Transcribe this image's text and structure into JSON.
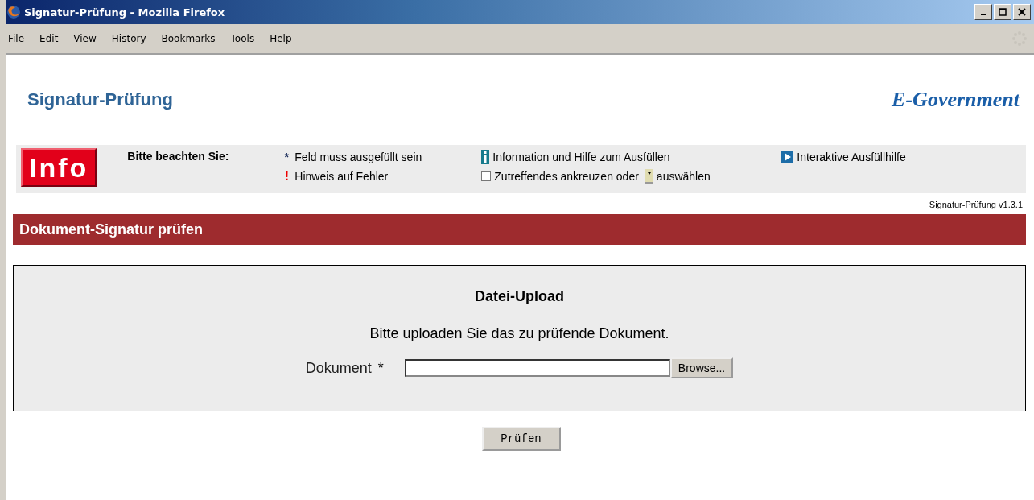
{
  "window": {
    "title": "Signatur-Prüfung - Mozilla Firefox"
  },
  "menu": [
    "File",
    "Edit",
    "View",
    "History",
    "Bookmarks",
    "Tools",
    "Help"
  ],
  "page": {
    "title": "Signatur-Prüfung",
    "logo": "E-Government",
    "version": "Signatur-Prüfung v1.3.1"
  },
  "info_bar": {
    "badge": "Info",
    "heading": "Bitte beachten Sie:",
    "columns": [
      [
        {
          "kind": "required",
          "symbol": "*",
          "text": "Feld muss ausgefüllt sein"
        },
        {
          "kind": "error",
          "symbol": "!",
          "text": "Hinweis auf Fehler"
        }
      ],
      [
        {
          "kind": "info",
          "text": "Information und Hilfe zum Ausfüllen"
        },
        {
          "kind": "checkbox",
          "text": "Zutreffendes ankreuzen oder",
          "text_after": "auswählen"
        }
      ],
      [
        {
          "kind": "interactive",
          "text": "Interaktive Ausfüllhilfe"
        }
      ]
    ]
  },
  "section": {
    "title": "Dokument-Signatur prüfen"
  },
  "upload": {
    "title": "Datei-Upload",
    "instruction": "Bitte uploaden Sie das zu prüfende Dokument.",
    "label": "Dokument",
    "required_mark": "*",
    "browse": "Browse..."
  },
  "submit": "Prüfen"
}
